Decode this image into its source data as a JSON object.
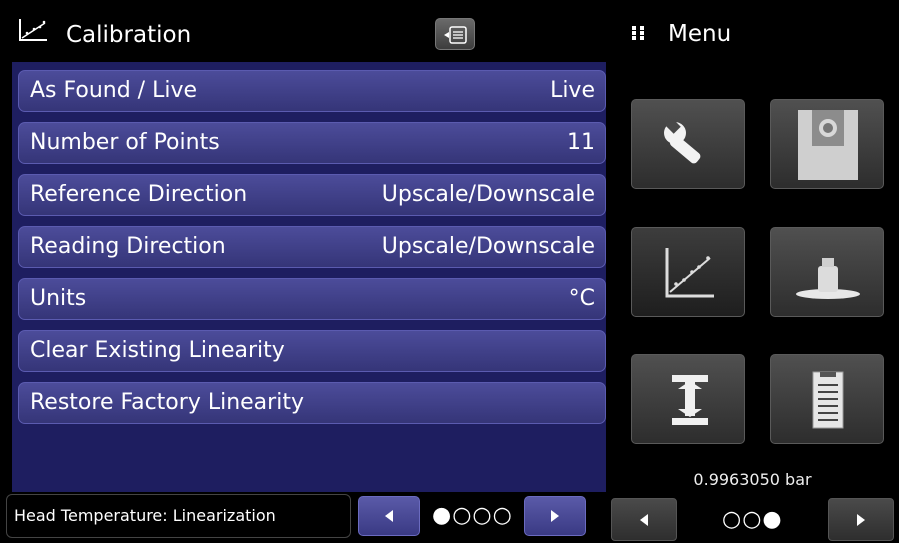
{
  "header": {
    "title": "Calibration",
    "icon": "linearity-chart-icon",
    "keyboard_icon": "keyboard-icon"
  },
  "rows": [
    {
      "label": "As Found / Live",
      "value": "Live"
    },
    {
      "label": "Number of Points",
      "value": "11"
    },
    {
      "label": "Reference Direction",
      "value": "Upscale/Downscale"
    },
    {
      "label": "Reading Direction",
      "value": "Upscale/Downscale"
    },
    {
      "label": "Units",
      "value": "°C"
    },
    {
      "label": "Clear Existing Linearity",
      "value": ""
    },
    {
      "label": "Restore Factory Linearity",
      "value": ""
    }
  ],
  "footer": {
    "status": "Head Temperature: Linearization",
    "page_dots": "●○○○"
  },
  "menu": {
    "title": "Menu",
    "tiles": [
      "wrench-icon",
      "sensor-module-icon",
      "linearity-chart-icon",
      "weight-icon",
      "leak-test-icon",
      "document-icon"
    ],
    "pressure_reading": "0.9963050 bar",
    "page_dots": "○○●"
  },
  "colors": {
    "panel_bg": "#1e1e60",
    "row_bg": "#40408a",
    "tile_bg": "#3e3e3e"
  }
}
